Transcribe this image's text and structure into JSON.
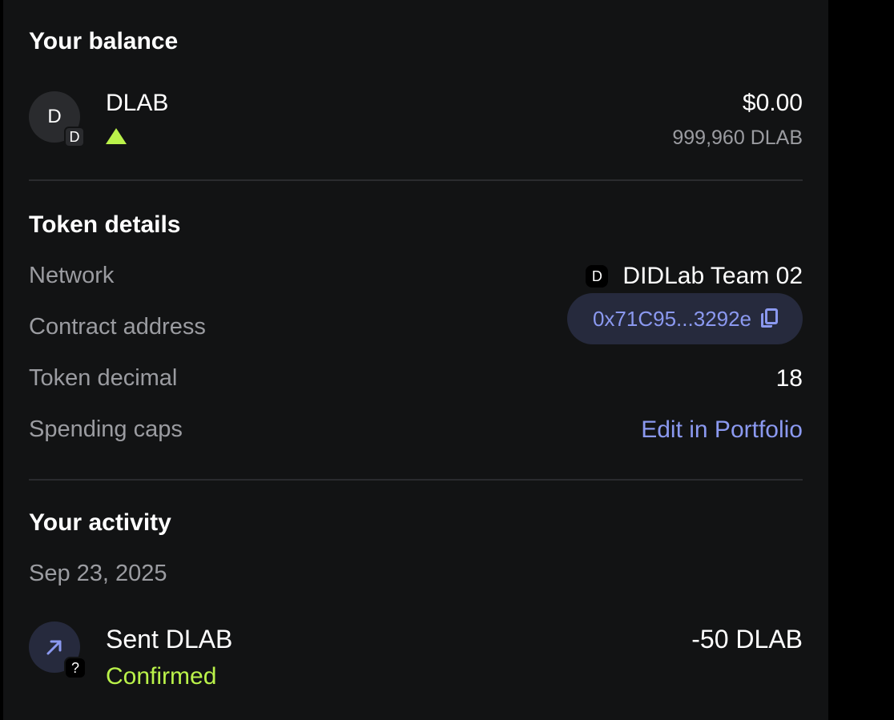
{
  "balance": {
    "title": "Your balance",
    "token": {
      "avatar_letter": "D",
      "badge_letter": "D",
      "name": "DLAB",
      "trend_icon": "triangle-up-icon",
      "fiat_value": "$0.00",
      "amount": "999,960 DLAB"
    }
  },
  "details": {
    "title": "Token details",
    "network_label": "Network",
    "network_icon_letter": "D",
    "network_value": "DIDLab Team 02",
    "contract_label": "Contract address",
    "contract_value": "0x71C95...3292e",
    "decimal_label": "Token decimal",
    "decimal_value": "18",
    "spending_label": "Spending caps",
    "spending_link": "Edit in Portfolio"
  },
  "activity": {
    "title": "Your activity",
    "date": "Sep 23, 2025",
    "items": [
      {
        "icon": "arrow-up-right-icon",
        "badge": "?",
        "title": "Sent DLAB",
        "status": "Confirmed",
        "amount": "-50 DLAB"
      }
    ]
  },
  "colors": {
    "background": "#121314",
    "accent_link": "#8b99f0",
    "success": "#baf24a",
    "muted_text": "#9b9ca1"
  }
}
